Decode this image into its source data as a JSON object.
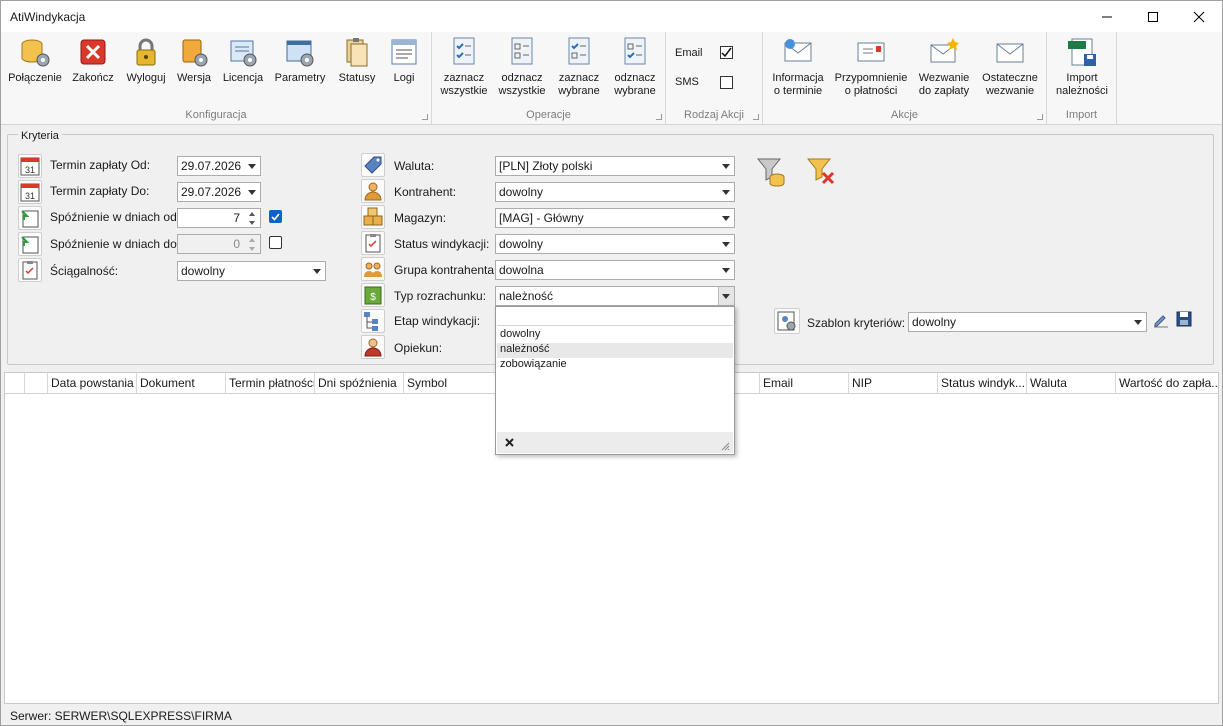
{
  "window": {
    "title": "AtiWindykacja"
  },
  "ribbon": {
    "konfiguracja": {
      "label": "Konfiguracja",
      "buttons": [
        "Połączenie",
        "Zakończ",
        "Wyloguj",
        "Wersja",
        "Licencja",
        "Parametry",
        "Statusy",
        "Logi"
      ]
    },
    "operacje": {
      "label": "Operacje",
      "buttons": [
        [
          "zaznacz",
          "wszystkie"
        ],
        [
          "odznacz",
          "wszystkie"
        ],
        [
          "zaznacz",
          "wybrane"
        ],
        [
          "odznacz",
          "wybrane"
        ]
      ]
    },
    "rodzaj": {
      "label": "Rodzaj Akcji",
      "email": "Email",
      "sms": "SMS",
      "email_checked": true,
      "sms_checked": false
    },
    "akcje": {
      "label": "Akcje",
      "buttons": [
        [
          "Informacja",
          "o terminie"
        ],
        [
          "Przypomnienie",
          "o płatności"
        ],
        [
          "Wezwanie",
          "do zapłaty"
        ],
        [
          "Ostateczne",
          "wezwanie"
        ]
      ]
    },
    "import": {
      "label": "Import",
      "button": [
        "Import",
        "należności"
      ]
    }
  },
  "kryteria": {
    "legend": "Kryteria",
    "termin_od": {
      "label": "Termin zapłaty Od:",
      "value": "29.07.2026"
    },
    "termin_do": {
      "label": "Termin zapłaty  Do:",
      "value": "29.07.2026"
    },
    "spoz_od": {
      "label": "Spóźnienie w dniach od:",
      "value": "7",
      "checked": true
    },
    "spoz_do": {
      "label": "Spóźnienie w dniach do:",
      "value": "0",
      "checked": false
    },
    "sciagalnosc": {
      "label": "Ściągalność:",
      "value": "dowolny"
    },
    "waluta": {
      "label": "Waluta:",
      "value": "[PLN] Złoty polski"
    },
    "kontrahent": {
      "label": "Kontrahent:",
      "value": "dowolny"
    },
    "magazyn": {
      "label": "Magazyn:",
      "value": "[MAG] - Główny"
    },
    "status": {
      "label": "Status windykacji:",
      "value": "dowolny"
    },
    "grupa": {
      "label": "Grupa kontrahenta:",
      "value": "dowolna"
    },
    "typ": {
      "label": "Typ rozrachunku:",
      "value": "należność"
    },
    "etap": {
      "label": "Etap windykacji:"
    },
    "opiekun": {
      "label": "Opiekun:"
    },
    "szablon": {
      "label": "Szablon kryteriów:",
      "value": "dowolny"
    }
  },
  "dropdown": {
    "options": [
      "dowolny",
      "należność",
      "zobowiązanie"
    ],
    "selected_index": 1
  },
  "grid": {
    "columns": [
      "Data powstania",
      "Dokument",
      "Termin płatności",
      "Dni spóźnienia",
      "Symbol",
      "Email",
      "NIP",
      "Status windyk...",
      "Waluta",
      "Wartość do zapła..."
    ]
  },
  "status_bar": {
    "text": "Serwer: SERWER\\SQLEXPRESS\\FIRMA"
  }
}
